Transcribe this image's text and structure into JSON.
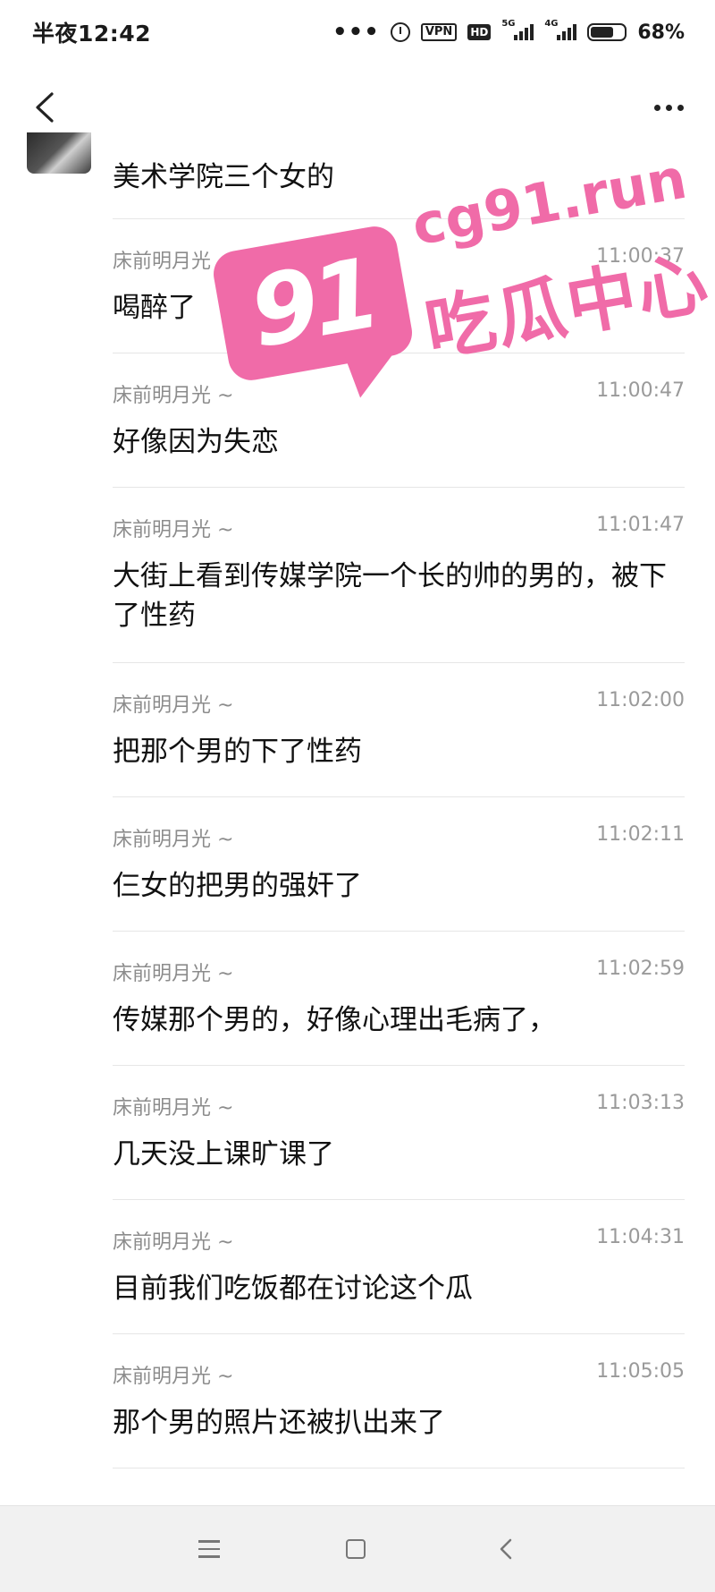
{
  "status_bar": {
    "time": "半夜12:42",
    "dots": "•••",
    "vpn": "VPN",
    "hd": "HD",
    "net1": "5G",
    "net2": "4G",
    "battery_level": 0.68,
    "battery_text": "68%"
  },
  "watermark": {
    "number": "91",
    "domain": "cg91.run",
    "title": "吃瓜中心",
    "color": "#f06ba8"
  },
  "first_message": "美术学院三个女的",
  "messages": [
    {
      "sender": "床前明月光 ~",
      "time": "11:00:37",
      "text": "喝醉了"
    },
    {
      "sender": "床前明月光 ~",
      "time": "11:00:47",
      "text": "好像因为失恋"
    },
    {
      "sender": "床前明月光 ~",
      "time": "11:01:47",
      "text": "大街上看到传媒学院一个长的帅的男的，被下了性药"
    },
    {
      "sender": "床前明月光 ~",
      "time": "11:02:00",
      "text": "把那个男的下了性药"
    },
    {
      "sender": "床前明月光 ~",
      "time": "11:02:11",
      "text": "仨女的把男的强奸了"
    },
    {
      "sender": "床前明月光 ~",
      "time": "11:02:59",
      "text": "传媒那个男的，好像心理出毛病了，"
    },
    {
      "sender": "床前明月光 ~",
      "time": "11:03:13",
      "text": "几天没上课旷课了"
    },
    {
      "sender": "床前明月光 ~",
      "time": "11:04:31",
      "text": "目前我们吃饭都在讨论这个瓜"
    },
    {
      "sender": "床前明月光 ~",
      "time": "11:05:05",
      "text": "那个男的照片还被扒出来了"
    }
  ]
}
